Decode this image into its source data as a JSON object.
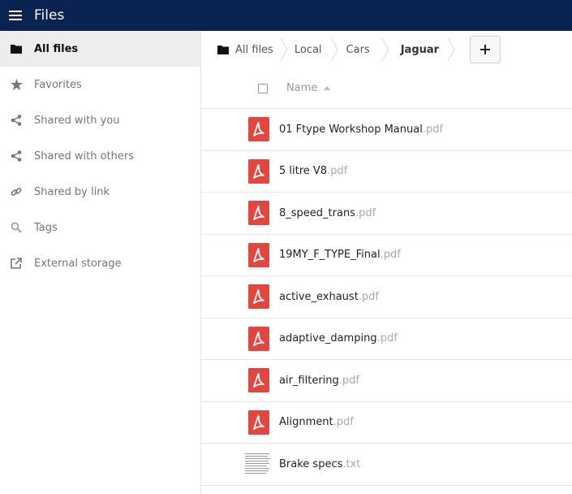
{
  "header": {
    "title": "Files"
  },
  "sidebar": {
    "items": [
      {
        "label": "All files",
        "icon": "folder-icon",
        "active": true
      },
      {
        "label": "Favorites",
        "icon": "star-icon"
      },
      {
        "label": "Shared with you",
        "icon": "share-icon"
      },
      {
        "label": "Shared with others",
        "icon": "share-icon"
      },
      {
        "label": "Shared by link",
        "icon": "link-icon"
      },
      {
        "label": "Tags",
        "icon": "search-icon"
      },
      {
        "label": "External storage",
        "icon": "external-link-icon"
      }
    ]
  },
  "breadcrumbs": [
    "All files",
    "Local",
    "Cars",
    "Jaguar"
  ],
  "list": {
    "column_name": "Name",
    "files": [
      {
        "base": "01 Ftype  Workshop Manual",
        "ext": ".pdf",
        "type": "pdf"
      },
      {
        "base": "5 litre V8",
        "ext": ".pdf",
        "type": "pdf"
      },
      {
        "base": "8_speed_trans",
        "ext": ".pdf",
        "type": "pdf"
      },
      {
        "base": "19MY_F_TYPE_Final",
        "ext": ".pdf",
        "type": "pdf"
      },
      {
        "base": "active_exhaust",
        "ext": ".pdf",
        "type": "pdf"
      },
      {
        "base": "adaptive_damping",
        "ext": ".pdf",
        "type": "pdf"
      },
      {
        "base": "air_filtering",
        "ext": ".pdf",
        "type": "pdf"
      },
      {
        "base": "Alignment",
        "ext": ".pdf",
        "type": "pdf"
      },
      {
        "base": "Brake specs",
        "ext": ".txt",
        "type": "txt"
      }
    ]
  },
  "colors": {
    "header_bg": "#0b2350",
    "pdf_red": "#e2473f",
    "active_bg": "#ededed"
  }
}
